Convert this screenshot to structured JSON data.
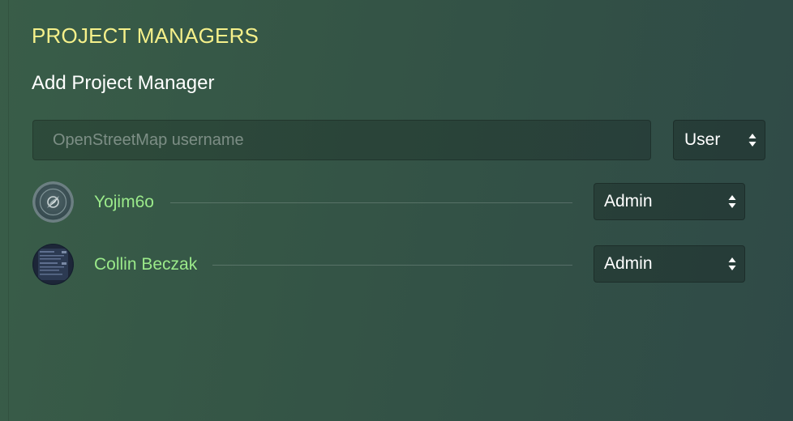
{
  "section": {
    "title": "PROJECT MANAGERS",
    "subheading": "Add Project Manager"
  },
  "add_form": {
    "username_placeholder": "OpenStreetMap username",
    "username_value": "",
    "role_selected": "User"
  },
  "managers": [
    {
      "name": "Yojim6o",
      "role_selected": "Admin",
      "avatar_icon": "compass-avatar-icon"
    },
    {
      "name": "Collin Beczak",
      "role_selected": "Admin",
      "avatar_icon": "screenshot-avatar-image"
    }
  ],
  "colors": {
    "title": "#f5f08a",
    "manager_name": "#9bea8a",
    "background_start": "#395d48",
    "background_end": "#2f4a47"
  }
}
